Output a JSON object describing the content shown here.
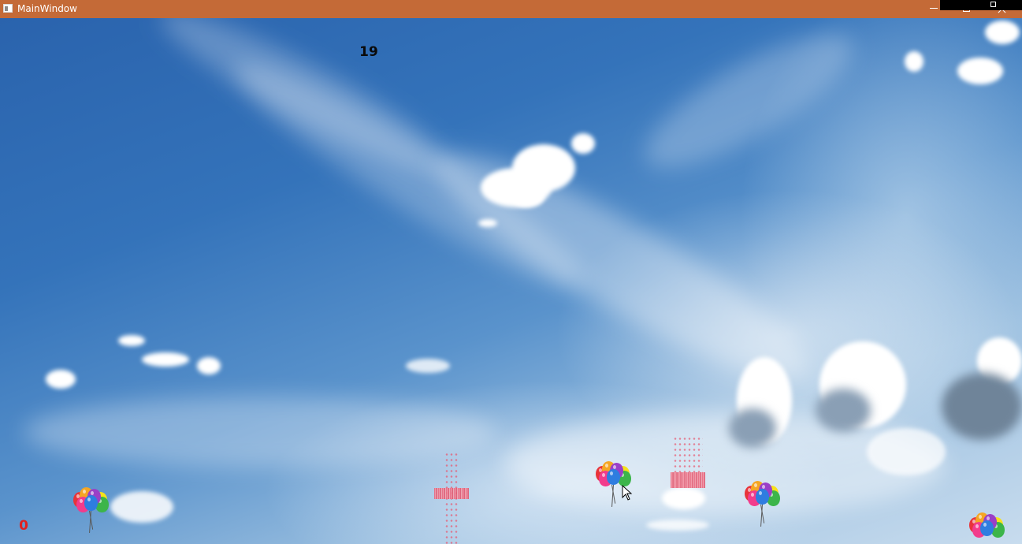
{
  "window": {
    "title": "MainWindow",
    "titlebar_color": "#c46a37",
    "controls": [
      "minimize-icon",
      "maximize-icon",
      "close-icon"
    ]
  },
  "hud": {
    "timer": "19",
    "score": "0",
    "score_color": "#e02020"
  },
  "balloon_colors": [
    "#e8343a",
    "#f5a623",
    "#2e7de0",
    "#3cb54a",
    "#9b3fc7",
    "#f23c8c",
    "#f7e11b"
  ],
  "scene": {
    "background": "sky-with-clouds",
    "balloon_bunches": 4,
    "popped_balloons": 2
  }
}
